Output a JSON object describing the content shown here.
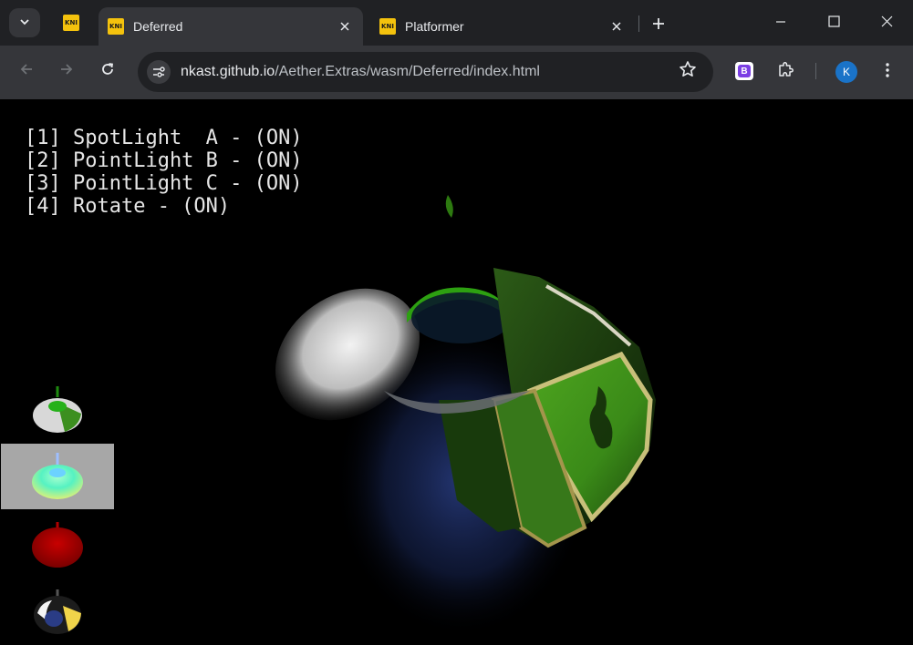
{
  "browser": {
    "tabs": [
      {
        "title": "",
        "favicon_text": "KNI",
        "pinned": true
      },
      {
        "title": "Deferred",
        "favicon_text": "KNI",
        "active": true
      },
      {
        "title": "Platformer",
        "favicon_text": "KNI",
        "active": false
      }
    ],
    "url": {
      "host": "nkast.github.io",
      "path": "/Aether.Extras/wasm/Deferred/index.html"
    },
    "profile_initial": "K",
    "extension_label": "B"
  },
  "hud": {
    "lines": [
      "[1] SpotLight  A - (ON)",
      "[2] PointLight B - (ON)",
      "[3] PointLight C - (ON)",
      "[4] Rotate - (ON)"
    ]
  },
  "render_targets": {
    "selected_index": 1,
    "items": [
      "diffuse",
      "normal",
      "depth",
      "light"
    ]
  },
  "colors": {
    "tab_active": "#35363a",
    "tab_strip": "#202124",
    "favicon": "#f4c20d",
    "hud_text": "#e6e6e6",
    "thumb_selected": "#a7a7a7"
  },
  "icons": [
    "chevron-down-icon",
    "close-icon",
    "plus-icon",
    "minimize-icon",
    "maximize-icon",
    "back-icon",
    "forward-icon",
    "reload-icon",
    "site-settings-icon",
    "star-icon",
    "puzzle-icon",
    "kebab-menu-icon"
  ]
}
